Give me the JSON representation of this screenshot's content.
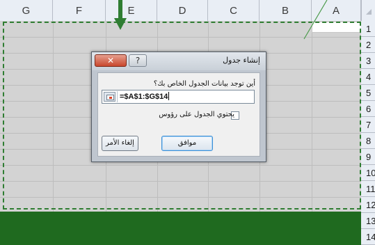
{
  "sheet": {
    "columns": [
      "G",
      "F",
      "E",
      "D",
      "C",
      "B",
      "A"
    ],
    "rows": [
      "1",
      "2",
      "3",
      "4",
      "5",
      "6",
      "7",
      "8",
      "9",
      "10",
      "11",
      "12",
      "13",
      "14"
    ]
  },
  "dialog": {
    "title": "إنشاء جدول",
    "prompt": "أين توجد بيانات الجدول الخاص بك؟",
    "range_value": "=$A$1:$G$14",
    "headers_label": "يحتوي الجدول على رؤوس",
    "headers_checked": false,
    "ok_label": "موافق",
    "cancel_label": "إلغاء الأمر",
    "close_glyph": "✕",
    "help_glyph": "?"
  },
  "colors": {
    "accent_green": "#2f7d32",
    "close_red": "#c8472d"
  },
  "icons": {
    "range_picker": "collapse-dialog-icon",
    "pointer": "down-arrow-icon"
  }
}
